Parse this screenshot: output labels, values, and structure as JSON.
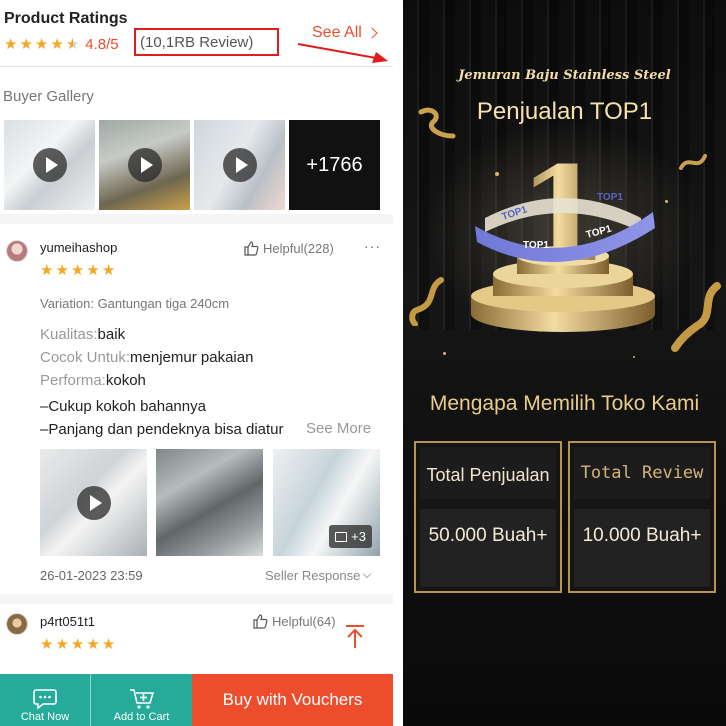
{
  "colors": {
    "accent": "#ee4d2d",
    "star": "#f5a623",
    "teal": "#26aa99",
    "gold": "#d4b47a",
    "highlight_box": "#e21b1b"
  },
  "ratings": {
    "title": "Product Ratings",
    "score": "4.8/5",
    "review_count": "(10,1RB Review)",
    "see_all": "See All"
  },
  "gallery": {
    "title": "Buyer Gallery",
    "more_count": "+1766"
  },
  "reviews": [
    {
      "username": "yumeihashop",
      "helpful": "Helpful(228)",
      "stars": 5,
      "variation": "Variation: Gantungan tiga 240cm",
      "attributes": [
        {
          "key": "Kualitas:",
          "value": "baik"
        },
        {
          "key": "Cocok Untuk:",
          "value": "menjemur pakaian"
        },
        {
          "key": "Performa:",
          "value": "kokoh"
        }
      ],
      "comment_lines": [
        "–Cukup kokoh bahannya",
        "–Panjang dan pendeknya bisa diatur"
      ],
      "see_more": "See More",
      "photo_badge": "+3",
      "date": "26-01-2023 23:59",
      "seller_response": "Seller Response"
    },
    {
      "username": "p4rt051t1",
      "helpful": "Helpful(64)",
      "stars": 5
    }
  ],
  "bottom_bar": {
    "chat": "Chat Now",
    "cart": "Add to Cart",
    "buy": "Buy with Vouchers"
  },
  "promo": {
    "subtitle": "Jemuran Baju Stainless Steel",
    "title": "Penjualan TOP1",
    "trophy_number": "1",
    "ribbon_text": "TOP1",
    "why": "Mengapa Memilih Toko Kami",
    "stats": [
      {
        "label": "Total Penjualan",
        "value": "50.000 Buah+"
      },
      {
        "label": "Total Review",
        "value": "10.000 Buah+"
      }
    ]
  }
}
